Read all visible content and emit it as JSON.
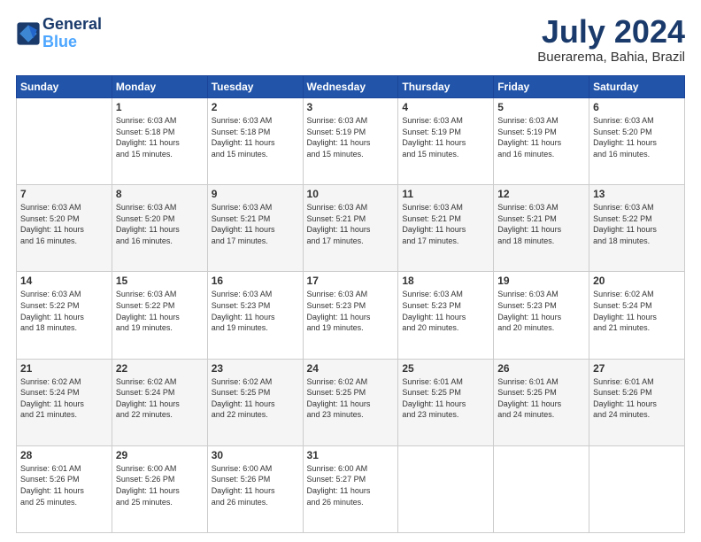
{
  "header": {
    "logo_line1": "General",
    "logo_line2": "Blue",
    "month_year": "July 2024",
    "location": "Buerarema, Bahia, Brazil"
  },
  "days_of_week": [
    "Sunday",
    "Monday",
    "Tuesday",
    "Wednesday",
    "Thursday",
    "Friday",
    "Saturday"
  ],
  "weeks": [
    [
      {
        "day": "",
        "info": ""
      },
      {
        "day": "1",
        "info": "Sunrise: 6:03 AM\nSunset: 5:18 PM\nDaylight: 11 hours\nand 15 minutes."
      },
      {
        "day": "2",
        "info": "Sunrise: 6:03 AM\nSunset: 5:18 PM\nDaylight: 11 hours\nand 15 minutes."
      },
      {
        "day": "3",
        "info": "Sunrise: 6:03 AM\nSunset: 5:19 PM\nDaylight: 11 hours\nand 15 minutes."
      },
      {
        "day": "4",
        "info": "Sunrise: 6:03 AM\nSunset: 5:19 PM\nDaylight: 11 hours\nand 15 minutes."
      },
      {
        "day": "5",
        "info": "Sunrise: 6:03 AM\nSunset: 5:19 PM\nDaylight: 11 hours\nand 16 minutes."
      },
      {
        "day": "6",
        "info": "Sunrise: 6:03 AM\nSunset: 5:20 PM\nDaylight: 11 hours\nand 16 minutes."
      }
    ],
    [
      {
        "day": "7",
        "info": "Sunrise: 6:03 AM\nSunset: 5:20 PM\nDaylight: 11 hours\nand 16 minutes."
      },
      {
        "day": "8",
        "info": "Sunrise: 6:03 AM\nSunset: 5:20 PM\nDaylight: 11 hours\nand 16 minutes."
      },
      {
        "day": "9",
        "info": "Sunrise: 6:03 AM\nSunset: 5:21 PM\nDaylight: 11 hours\nand 17 minutes."
      },
      {
        "day": "10",
        "info": "Sunrise: 6:03 AM\nSunset: 5:21 PM\nDaylight: 11 hours\nand 17 minutes."
      },
      {
        "day": "11",
        "info": "Sunrise: 6:03 AM\nSunset: 5:21 PM\nDaylight: 11 hours\nand 17 minutes."
      },
      {
        "day": "12",
        "info": "Sunrise: 6:03 AM\nSunset: 5:21 PM\nDaylight: 11 hours\nand 18 minutes."
      },
      {
        "day": "13",
        "info": "Sunrise: 6:03 AM\nSunset: 5:22 PM\nDaylight: 11 hours\nand 18 minutes."
      }
    ],
    [
      {
        "day": "14",
        "info": "Sunrise: 6:03 AM\nSunset: 5:22 PM\nDaylight: 11 hours\nand 18 minutes."
      },
      {
        "day": "15",
        "info": "Sunrise: 6:03 AM\nSunset: 5:22 PM\nDaylight: 11 hours\nand 19 minutes."
      },
      {
        "day": "16",
        "info": "Sunrise: 6:03 AM\nSunset: 5:23 PM\nDaylight: 11 hours\nand 19 minutes."
      },
      {
        "day": "17",
        "info": "Sunrise: 6:03 AM\nSunset: 5:23 PM\nDaylight: 11 hours\nand 19 minutes."
      },
      {
        "day": "18",
        "info": "Sunrise: 6:03 AM\nSunset: 5:23 PM\nDaylight: 11 hours\nand 20 minutes."
      },
      {
        "day": "19",
        "info": "Sunrise: 6:03 AM\nSunset: 5:23 PM\nDaylight: 11 hours\nand 20 minutes."
      },
      {
        "day": "20",
        "info": "Sunrise: 6:02 AM\nSunset: 5:24 PM\nDaylight: 11 hours\nand 21 minutes."
      }
    ],
    [
      {
        "day": "21",
        "info": "Sunrise: 6:02 AM\nSunset: 5:24 PM\nDaylight: 11 hours\nand 21 minutes."
      },
      {
        "day": "22",
        "info": "Sunrise: 6:02 AM\nSunset: 5:24 PM\nDaylight: 11 hours\nand 22 minutes."
      },
      {
        "day": "23",
        "info": "Sunrise: 6:02 AM\nSunset: 5:25 PM\nDaylight: 11 hours\nand 22 minutes."
      },
      {
        "day": "24",
        "info": "Sunrise: 6:02 AM\nSunset: 5:25 PM\nDaylight: 11 hours\nand 23 minutes."
      },
      {
        "day": "25",
        "info": "Sunrise: 6:01 AM\nSunset: 5:25 PM\nDaylight: 11 hours\nand 23 minutes."
      },
      {
        "day": "26",
        "info": "Sunrise: 6:01 AM\nSunset: 5:25 PM\nDaylight: 11 hours\nand 24 minutes."
      },
      {
        "day": "27",
        "info": "Sunrise: 6:01 AM\nSunset: 5:26 PM\nDaylight: 11 hours\nand 24 minutes."
      }
    ],
    [
      {
        "day": "28",
        "info": "Sunrise: 6:01 AM\nSunset: 5:26 PM\nDaylight: 11 hours\nand 25 minutes."
      },
      {
        "day": "29",
        "info": "Sunrise: 6:00 AM\nSunset: 5:26 PM\nDaylight: 11 hours\nand 25 minutes."
      },
      {
        "day": "30",
        "info": "Sunrise: 6:00 AM\nSunset: 5:26 PM\nDaylight: 11 hours\nand 26 minutes."
      },
      {
        "day": "31",
        "info": "Sunrise: 6:00 AM\nSunset: 5:27 PM\nDaylight: 11 hours\nand 26 minutes."
      },
      {
        "day": "",
        "info": ""
      },
      {
        "day": "",
        "info": ""
      },
      {
        "day": "",
        "info": ""
      }
    ]
  ]
}
